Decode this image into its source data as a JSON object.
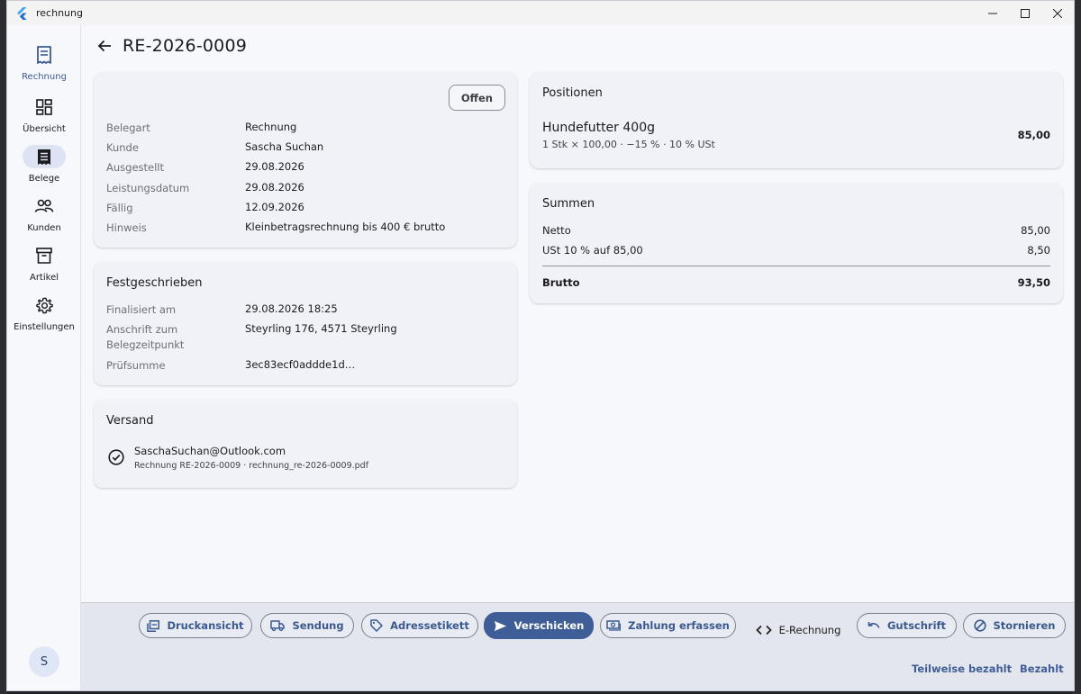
{
  "app": {
    "title": "rechnung"
  },
  "window_controls": {
    "minimize": "—",
    "maximize": "☐",
    "close": "✕"
  },
  "nav": {
    "brand": "Rechnung",
    "items": [
      {
        "label": "Übersicht",
        "icon": "dashboard-icon"
      },
      {
        "label": "Belege",
        "icon": "receipt-icon",
        "active": true
      },
      {
        "label": "Kunden",
        "icon": "people-icon"
      },
      {
        "label": "Artikel",
        "icon": "archive-box-icon"
      },
      {
        "label": "Einstellungen",
        "icon": "gear-icon"
      }
    ],
    "avatar_initial": "S"
  },
  "header": {
    "title": "RE-2026-0009"
  },
  "details": {
    "status": "Offen",
    "rows": [
      {
        "label": "Belegart",
        "value": "Rechnung"
      },
      {
        "label": "Kunde",
        "value": "Sascha Suchan"
      },
      {
        "label": "Ausgestellt",
        "value": "29.08.2026"
      },
      {
        "label": "Leistungsdatum",
        "value": "29.08.2026"
      },
      {
        "label": "Fällig",
        "value": "12.09.2026"
      },
      {
        "label": "Hinweis",
        "value": "Kleinbetragsrechnung bis 400 € brutto"
      }
    ]
  },
  "locked": {
    "title": "Festgeschrieben",
    "rows": [
      {
        "label": "Finalisiert am",
        "value": "29.08.2026 18:25"
      },
      {
        "label": "Anschrift zum\nBelegzeitpunkt",
        "value": "Steyrling 176, 4571 Steyrling"
      },
      {
        "label": "Prüfsumme",
        "value": "3ec83ecf0addde1d…"
      }
    ]
  },
  "shipping": {
    "title": "Versand",
    "email": "SaschaSuchan@Outlook.com",
    "detail": "Rechnung RE-2026-0009 · rechnung_re-2026-0009.pdf"
  },
  "positions": {
    "title": "Positionen",
    "items": [
      {
        "name": "Hundefutter 400g",
        "detail": "1 Stk × 100,00 · −15 % · 10 % USt",
        "amount": "85,00"
      }
    ]
  },
  "totals": {
    "title": "Summen",
    "netto_label": "Netto",
    "netto": "85,00",
    "ust_label": "USt 10 % auf 85,00",
    "ust": "8,50",
    "brutto_label": "Brutto",
    "brutto": "93,50"
  },
  "actions": {
    "print": "Druckansicht",
    "shipment": "Sendung",
    "label": "Adressetikett",
    "send": "Verschicken",
    "payment": "Zahlung erfassen",
    "einvoice": "E-Rechnung",
    "credit": "Gutschrift",
    "cancel": "Stornieren",
    "partial_paid": "Teilweise bezahlt",
    "paid": "Bezahlt"
  },
  "colors": {
    "primary": "#3f5d97",
    "active_nav": "#dde3f3",
    "card": "#f1f2f7",
    "background": "#f7f8fc"
  }
}
